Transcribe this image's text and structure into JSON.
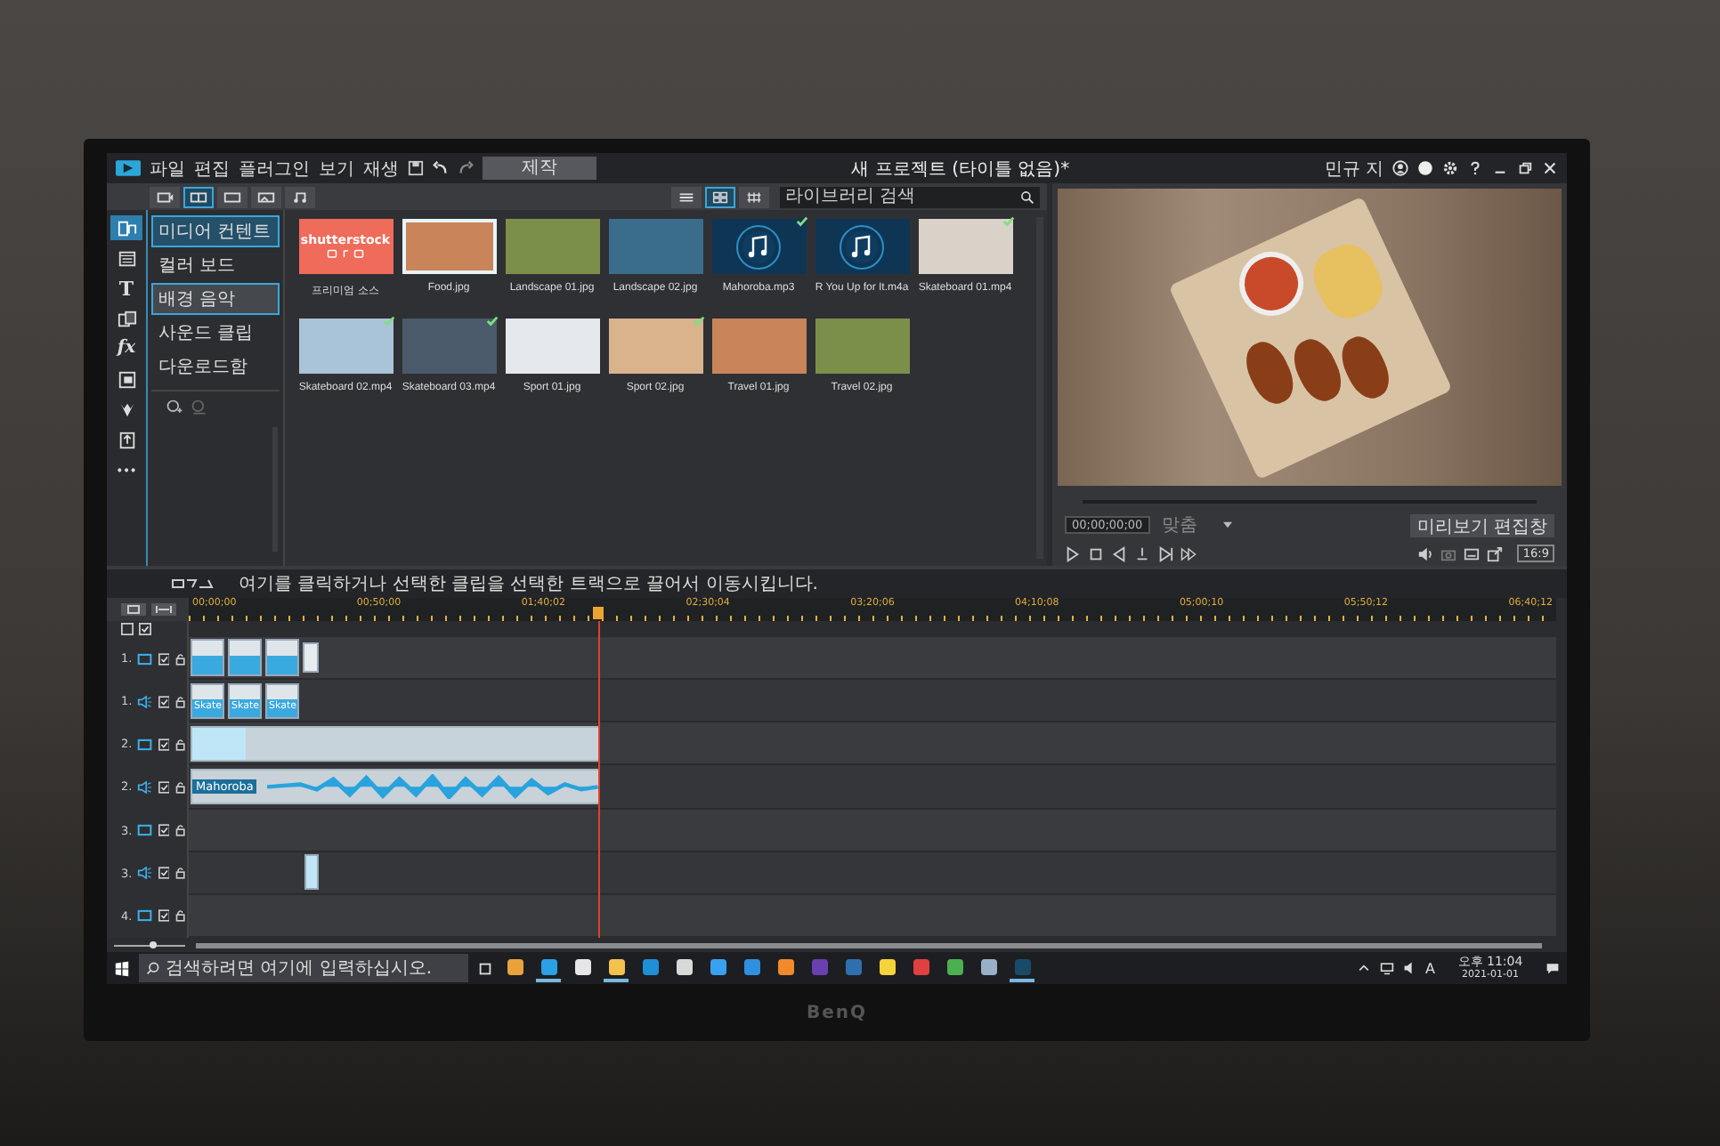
{
  "app": {
    "menu": [
      "파일",
      "편집",
      "플러그인",
      "보기",
      "재생"
    ],
    "produce_button": "제작",
    "title": "새 프로젝트 (타이틀 없음)*",
    "user": "민규 지"
  },
  "tools": [
    {
      "kind": "media",
      "selected": true
    },
    {
      "kind": "template",
      "selected": false
    },
    {
      "kind": "title",
      "label": "T",
      "selected": false
    },
    {
      "kind": "transition",
      "selected": false
    },
    {
      "kind": "effect",
      "label": "fx",
      "selected": false
    },
    {
      "kind": "overlay",
      "selected": false
    },
    {
      "kind": "paint",
      "selected": false
    },
    {
      "kind": "export",
      "selected": false
    },
    {
      "kind": "more",
      "label": "···",
      "selected": false
    }
  ],
  "library": {
    "tabs": [
      {
        "kind": "import",
        "selected": false
      },
      {
        "kind": "media",
        "selected": true
      },
      {
        "kind": "video",
        "selected": false
      },
      {
        "kind": "photo",
        "selected": false
      },
      {
        "kind": "audio",
        "selected": false
      }
    ],
    "views": [
      {
        "kind": "list",
        "selected": false
      },
      {
        "kind": "thumbs",
        "selected": true
      },
      {
        "kind": "grid",
        "selected": false
      }
    ],
    "search": {
      "placeholder": "라이브러리 검색"
    },
    "categories": [
      {
        "label": "미디어 컨텐트",
        "selected": true,
        "hovered": false
      },
      {
        "label": "컬러 보드",
        "selected": false,
        "hovered": false
      },
      {
        "label": "배경 음악",
        "selected": false,
        "hovered": true
      },
      {
        "label": "사운드 클립",
        "selected": false,
        "hovered": false
      },
      {
        "label": "다운로드함",
        "selected": false,
        "hovered": false
      }
    ],
    "items": [
      {
        "kind": "stock",
        "logo": "shutterstock",
        "label": "프리미엄 소스",
        "used": false,
        "selected": false
      },
      {
        "kind": "photo",
        "label": "Food.jpg",
        "used": false,
        "selected": true
      },
      {
        "kind": "photo",
        "label": "Landscape 01.jpg",
        "used": false,
        "selected": false
      },
      {
        "kind": "photo",
        "label": "Landscape 02.jpg",
        "used": false,
        "selected": false
      },
      {
        "kind": "audio",
        "label": "Mahoroba.mp3",
        "used": true,
        "selected": false
      },
      {
        "kind": "audio",
        "label": "R You Up for It.m4a",
        "used": false,
        "selected": false
      },
      {
        "kind": "video",
        "label": "Skateboard 01.mp4",
        "used": true,
        "selected": false
      },
      {
        "kind": "video",
        "label": "Skateboard 02.mp4",
        "used": true,
        "selected": false
      },
      {
        "kind": "video",
        "label": "Skateboard 03.mp4",
        "used": true,
        "selected": false
      },
      {
        "kind": "photo",
        "label": "Sport 01.jpg",
        "used": false,
        "selected": false
      },
      {
        "kind": "photo",
        "label": "Sport 02.jpg",
        "used": true,
        "selected": false
      },
      {
        "kind": "photo",
        "label": "Travel 01.jpg",
        "used": false,
        "selected": false
      },
      {
        "kind": "photo",
        "label": "Travel 02.jpg",
        "used": false,
        "selected": false
      }
    ]
  },
  "preview": {
    "timecode": "00;00;00;00",
    "zoom": "맞춤",
    "edit_button": "미리보기 편집창",
    "aspect": "16:9"
  },
  "timeline": {
    "hint": "여기를 클릭하거나 선택한 클립을 선택한 트랙으로 끌어서 이동시킵니다.",
    "ruler": [
      "00;00;00",
      "00;50;00",
      "01;40;02",
      "02;30;04",
      "03;20;06",
      "04;10;08",
      "05;00;10",
      "05;50;12",
      "06;40;12"
    ],
    "playhead": {
      "level": 0.3
    },
    "tracks": [
      {
        "number": "1.",
        "kind": "video",
        "enabled": true,
        "clips": [
          {
            "kind": "thumb"
          },
          {
            "kind": "thumb"
          },
          {
            "kind": "thumb"
          },
          {
            "kind": "small"
          }
        ]
      },
      {
        "number": "1.",
        "kind": "audio",
        "enabled": true,
        "clips": [
          {
            "kind": "thumb",
            "label": "Skate"
          },
          {
            "kind": "thumb",
            "label": "Skate"
          },
          {
            "kind": "thumb",
            "label": "Skate"
          }
        ]
      },
      {
        "number": "2.",
        "kind": "video",
        "enabled": true,
        "clips": [
          {
            "kind": "long"
          }
        ]
      },
      {
        "number": "2.",
        "kind": "audio",
        "enabled": true,
        "clips": [
          {
            "kind": "wave",
            "label": "Mahoroba"
          }
        ]
      },
      {
        "number": "3.",
        "kind": "video",
        "enabled": true
      },
      {
        "number": "3.",
        "kind": "audio",
        "enabled": true,
        "clips": [
          {
            "kind": "offset"
          }
        ]
      },
      {
        "number": "4.",
        "kind": "video",
        "enabled": true
      }
    ],
    "all_enabled": true,
    "zoom": {
      "level": 0.55
    }
  },
  "taskbar": {
    "search": {
      "placeholder": "검색하려면 여기에 입력하십시오."
    },
    "apps": [
      {
        "color": "#e8a33a",
        "selected": false
      },
      {
        "color": "#2aa0e6",
        "selected": true
      },
      {
        "color": "#e6e6e6",
        "selected": false
      },
      {
        "color": "#f2c14e",
        "selected": true
      },
      {
        "color": "#1f8fd6",
        "selected": false
      },
      {
        "color": "#d9d9d9",
        "selected": false
      },
      {
        "color": "#3aa0f0",
        "selected": false
      },
      {
        "color": "#2f8fe0",
        "selected": false
      },
      {
        "color": "#f08a2a",
        "selected": false
      },
      {
        "color": "#6a3fb0",
        "selected": false
      },
      {
        "color": "#2f6fb0",
        "selected": false
      },
      {
        "color": "#f5d33a",
        "selected": false
      },
      {
        "color": "#e04040",
        "selected": false
      },
      {
        "color": "#4caf50",
        "selected": false
      },
      {
        "color": "#9ab0c8",
        "selected": false
      },
      {
        "color": "#1a4a6a",
        "selected": true
      }
    ],
    "ime": "A",
    "time": "오후 11:04",
    "date": "2021-01-01"
  },
  "monitor": {
    "brand": "BenQ"
  }
}
